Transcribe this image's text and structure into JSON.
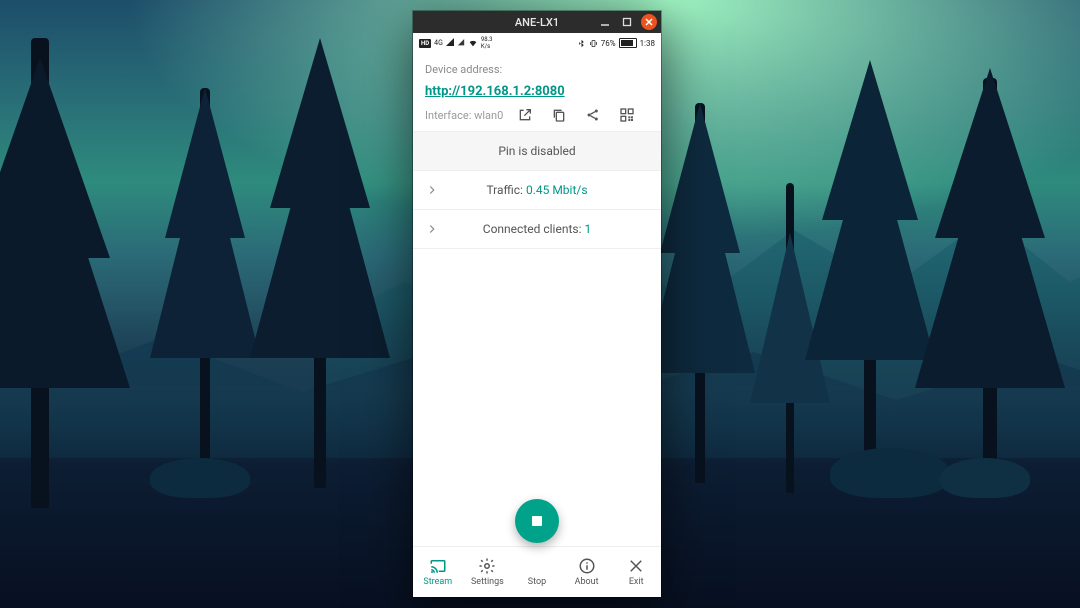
{
  "window": {
    "title": "ANE-LX1"
  },
  "statusbar": {
    "kbs_top": "98.3",
    "kbs_bot": "K/s",
    "hd": "HD",
    "signal_gen": "4G",
    "battery_pct": "76%",
    "time": "1:38"
  },
  "address": {
    "label": "Device address:",
    "url": "http://192.168.1.2:8080",
    "interface_label": "Interface:",
    "interface_value": "wlan0"
  },
  "rows": {
    "pin": "Pin is disabled",
    "traffic_label": "Traffic:",
    "traffic_value": "0.45 Mbit/s",
    "clients_label": "Connected clients:",
    "clients_value": "1"
  },
  "nav": {
    "stream": "Stream",
    "settings": "Settings",
    "stop": "Stop",
    "about": "About",
    "exit": "Exit"
  }
}
